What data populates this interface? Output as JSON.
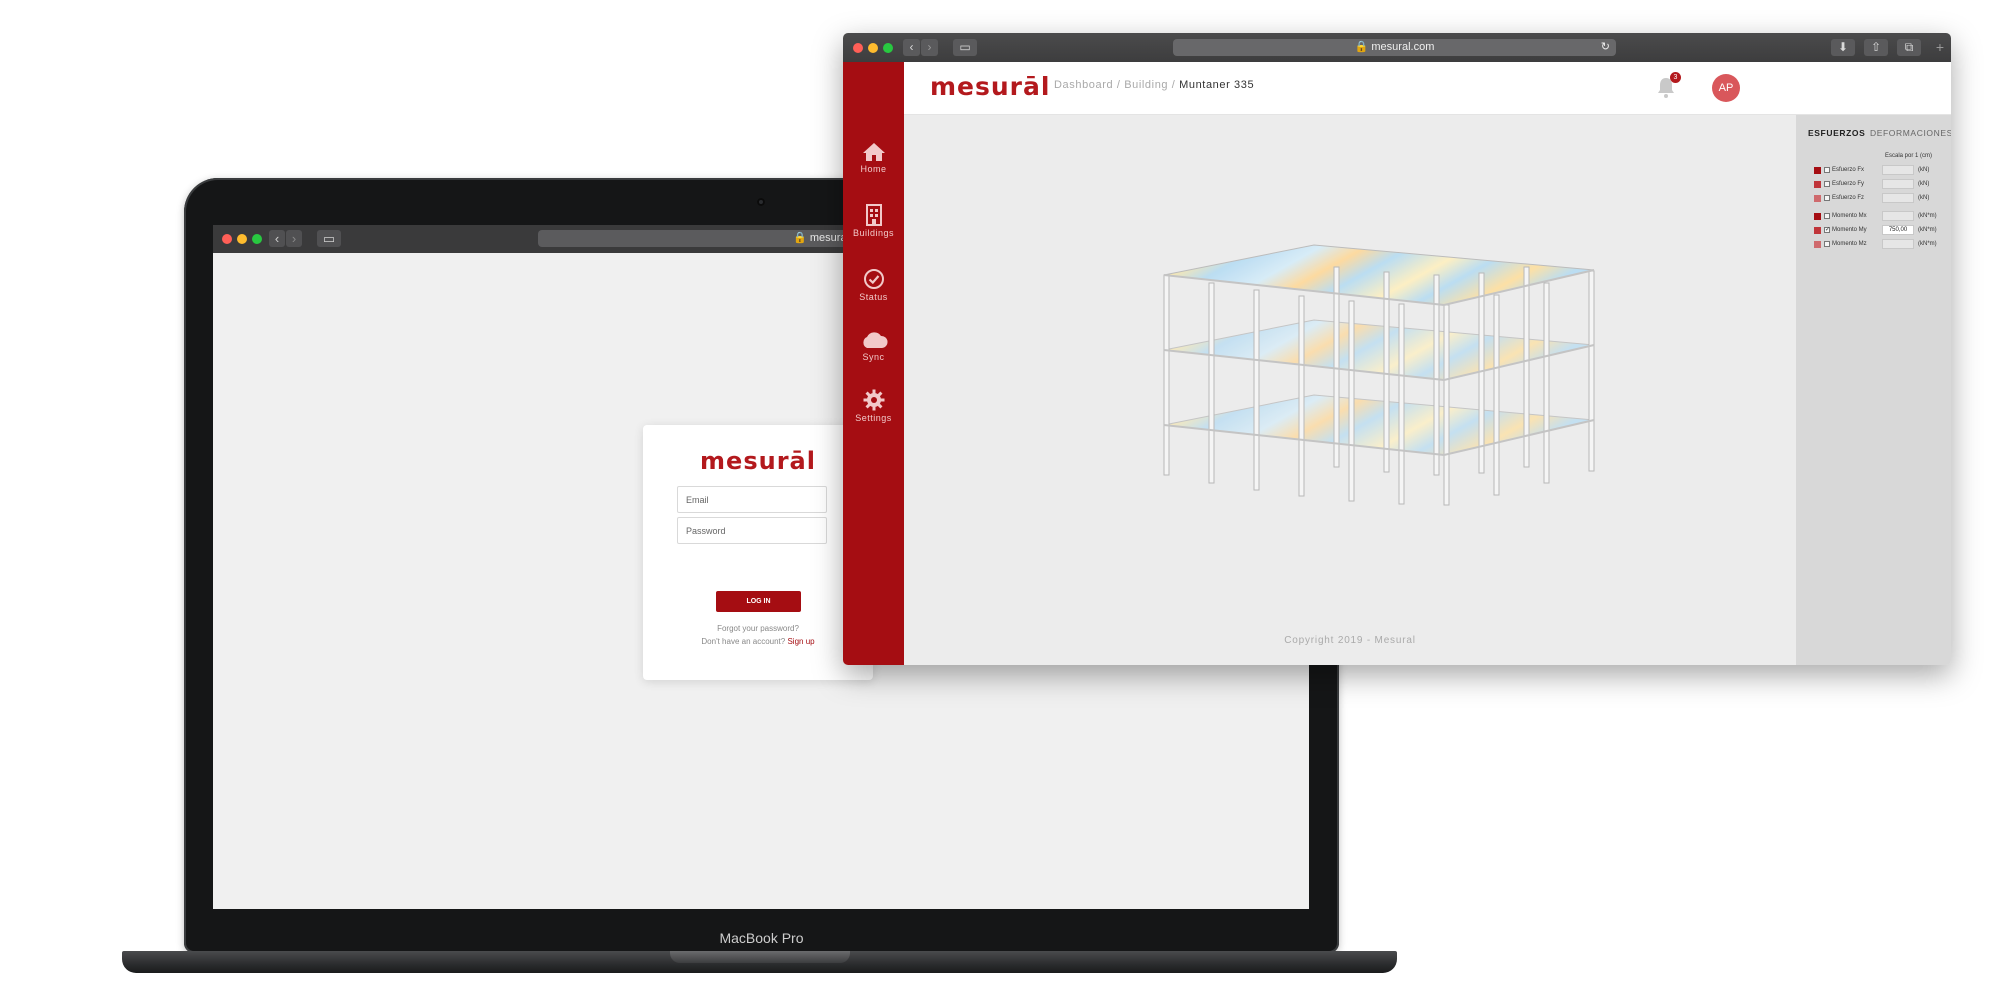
{
  "laptop": {
    "device_label": "MacBook Pro",
    "url": "mesural.com",
    "login": {
      "logo": "mesurāl",
      "email_placeholder": "Email",
      "password_placeholder": "Password",
      "login_button": "LOG IN",
      "forgot_password": "Forgot your password?",
      "no_account": "Don't have an account?",
      "sign_up": "Sign up"
    }
  },
  "browser": {
    "url": "mesural.com",
    "header": {
      "logo": "mesurāl",
      "breadcrumb": [
        "Dashboard",
        "Building",
        "Muntaner 335"
      ],
      "notification_count": "3",
      "avatar_initials": "AP"
    },
    "sidebar": {
      "items": [
        {
          "label": "Home",
          "icon": "home-icon"
        },
        {
          "label": "Buildings",
          "icon": "building-icon"
        },
        {
          "label": "Status",
          "icon": "check-circle-icon"
        },
        {
          "label": "Sync",
          "icon": "cloud-icon"
        },
        {
          "label": "Settings",
          "icon": "gear-icon"
        }
      ]
    },
    "panel": {
      "tabs": [
        "ESFUERZOS",
        "DEFORMACIONES"
      ],
      "active_tab": "ESFUERZOS",
      "scale_label": "Escala por 1",
      "scale_unit": "(cm)",
      "rows": [
        {
          "label": "Esfuerzo Fx",
          "unit": "(kN)",
          "value": "",
          "checked": false,
          "color": "#a50d12"
        },
        {
          "label": "Esfuerzo Fy",
          "unit": "(kN)",
          "value": "",
          "checked": false,
          "color": "#c0353a"
        },
        {
          "label": "Esfuerzo Fz",
          "unit": "(kN)",
          "value": "",
          "checked": false,
          "color": "#cf6a6d"
        },
        {
          "label": "Momento Mx",
          "unit": "(kN*m)",
          "value": "",
          "checked": false,
          "color": "#a50d12"
        },
        {
          "label": "Momento My",
          "unit": "(kN*m)",
          "value": "750,00",
          "checked": true,
          "color": "#c0353a"
        },
        {
          "label": "Momento Mz",
          "unit": "(kN*m)",
          "value": "",
          "checked": false,
          "color": "#cf6a6d"
        }
      ]
    },
    "footer": "Copyright 2019 - Mesural"
  },
  "colors": {
    "brand_red": "#a50d12",
    "panel_bg": "#d8d8d8",
    "viewport_bg": "#ececec"
  }
}
